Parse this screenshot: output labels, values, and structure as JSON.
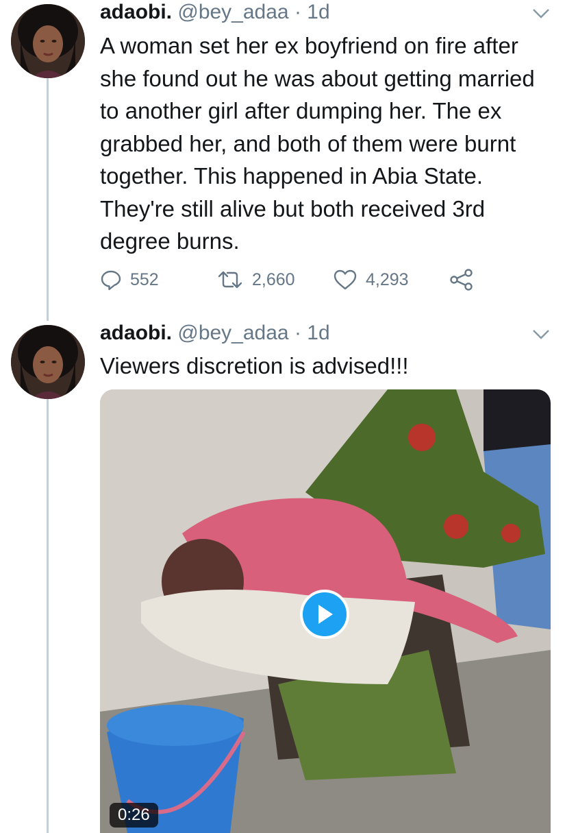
{
  "tweets": [
    {
      "name": "adaobi.",
      "handle": "@bey_adaa",
      "separator": "·",
      "time": "1d",
      "text": "A woman set her ex boyfriend on fire after she found out he was about getting married to another girl after dumping her. The ex grabbed her, and both of them were burnt together. This happened in Abia State. They're still alive but both received 3rd degree burns.",
      "actions": {
        "reply_count": "552",
        "retweet_count": "2,660",
        "like_count": "4,293"
      }
    },
    {
      "name": "adaobi.",
      "handle": "@bey_adaa",
      "separator": "·",
      "time": "1d",
      "text": "Viewers discretion is advised!!!",
      "media": {
        "type": "video",
        "duration": "0:26"
      }
    }
  ],
  "colors": {
    "accent": "#1da1f2",
    "secondary_text": "#657786",
    "thread_line": "#c4cfd6"
  },
  "icons": [
    "reply-icon",
    "retweet-icon",
    "like-icon",
    "share-icon",
    "chevron-down-icon",
    "play-icon"
  ]
}
